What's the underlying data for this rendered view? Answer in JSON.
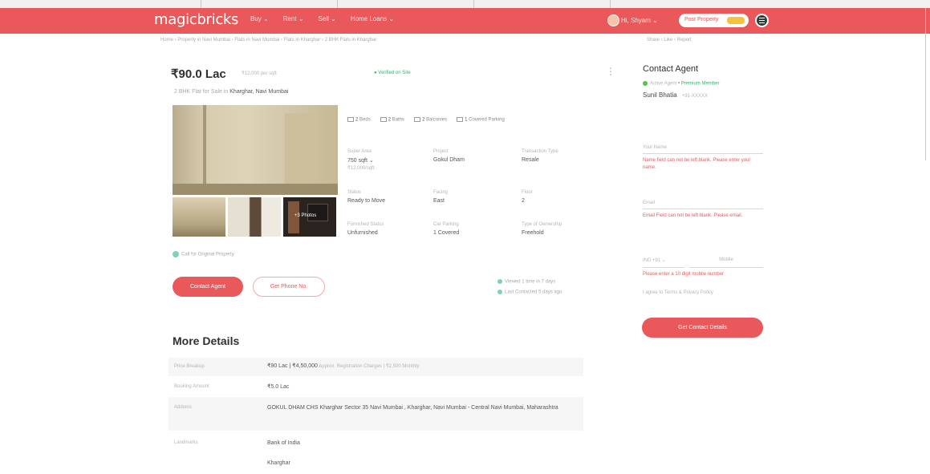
{
  "header": {
    "logo": "magicbricks",
    "nav": [
      "Buy ⌄",
      "Rent ⌄",
      "Sell ⌄",
      "Home Loans ⌄"
    ],
    "user": "Hi, Shyam ⌄",
    "post_button": "Post Property",
    "brand_color": "#e9585a"
  },
  "breadcrumb": "Home › Property in Navi Mumbai › Flats in Navi Mumbai › Flats in Kharghar › 2 BHK Flats in Kharghar",
  "side_links": "Share › Like › Report",
  "listing": {
    "price": "₹90.0 Lac",
    "price_sub": "₹12,000 per sqft",
    "verified": "● Verified on Site",
    "more_icon": "⋮",
    "location_prefix": "2 BHK Flat for Sale in",
    "location": "Kharghar, Navi Mumbai"
  },
  "gallery": {
    "thumb_label": "+3 Photos",
    "note": "Call for Original Property"
  },
  "features": [
    {
      "value": "2",
      "label": "Beds"
    },
    {
      "value": "2",
      "label": "Baths"
    },
    {
      "value": "2",
      "label": "Balconies"
    },
    {
      "value": "1",
      "label": "Covered Parking"
    }
  ],
  "attributes": [
    {
      "key": "Super Area",
      "value": "750 sqft ⌄",
      "sub": "₹12,000/sqft"
    },
    {
      "key": "Project",
      "value": "Gokul Dham",
      "sub": ""
    },
    {
      "key": "Transaction Type",
      "value": "Resale",
      "sub": ""
    },
    {
      "key": "Status",
      "value": "Ready to Move",
      "sub": ""
    },
    {
      "key": "Facing",
      "value": "East",
      "sub": ""
    },
    {
      "key": "Floor",
      "value": "2",
      "sub": ""
    },
    {
      "key": "Furnished Status",
      "value": "Unfurnished",
      "sub": ""
    },
    {
      "key": "Car Parking",
      "value": "1 Covered",
      "sub": ""
    },
    {
      "key": "Type of Ownership",
      "value": "Freehold",
      "sub": ""
    }
  ],
  "actions": {
    "contact": "Contact Agent",
    "phone": "Get Phone No.",
    "meta1": "Viewed 1 time in 7 days",
    "meta2": "Last Contacted 5 days ago"
  },
  "contact_panel": {
    "title": "Contact Agent",
    "status_prefix": "Active Agent",
    "status_tag": "• Premium Member",
    "agent_name": "Sunil Bhatia",
    "agent_sub": "+91-XXXXX",
    "name_placeholder": "Your Name",
    "name_error": "Name field can not be left blank. Please enter your name.",
    "email_placeholder": "Email",
    "email_error": "Email Field can not be left blank. Please email.",
    "country_code": "IND +91 ⌄",
    "phone_placeholder": "Mobile",
    "phone_error": "Please enter a 10 digit mobile number",
    "checkbox_text": "I agree to Terms & Privacy Policy",
    "submit": "Get Contact Details"
  },
  "more_details": {
    "title": "More Details",
    "rows": [
      {
        "key": "Price Breakup",
        "value": "₹90 Lac | ₹4,50,000",
        "extra": " Approx. Registration Charges | ₹2,500 Monthly",
        "shade": true
      },
      {
        "key": "Booking Amount",
        "value": "₹5.0 Lac",
        "extra": "",
        "shade": false
      },
      {
        "key": "Address",
        "value": "GOKUL DHAM CHS Kharghar Sector 35 Navi Mumbai , Kharghar, Navi Mumbai - Central Navi Mumbai, Maharashtra",
        "extra": "",
        "shade": true
      },
      {
        "key": "Landmarks",
        "value": "Bank of India",
        "extra": "",
        "shade": false
      },
      {
        "key": "",
        "value": "Kharghar",
        "extra": "",
        "shade": false
      }
    ]
  }
}
